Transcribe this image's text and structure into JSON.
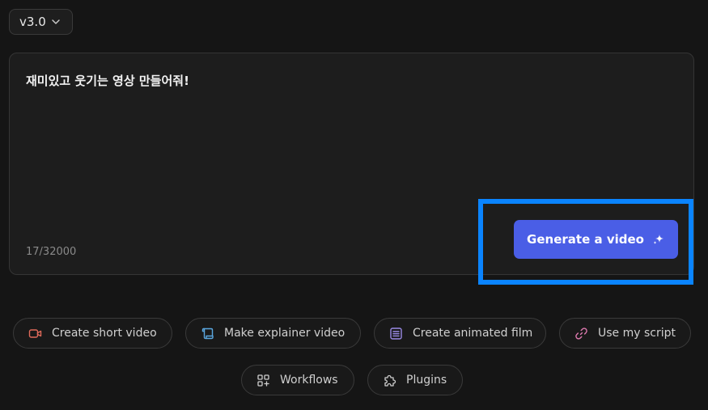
{
  "version_selector": {
    "label": "v3.0",
    "icon": "chevron-down-icon"
  },
  "prompt": {
    "text": "재미있고 웃기는 영상 만들어줘!",
    "char_count": "17/32000"
  },
  "generate_button": {
    "label": "Generate a video",
    "icon": "sparkle-icon",
    "color": "#4a5ee6",
    "highlight_color": "#0a84ff"
  },
  "quick_actions": [
    {
      "label": "Create short video",
      "icon": "video-camera-icon",
      "color": "#e06a5a"
    },
    {
      "label": "Make explainer video",
      "icon": "scroll-icon",
      "color": "#5aa7e0"
    },
    {
      "label": "Create animated film",
      "icon": "list-document-icon",
      "color": "#9a8ae6"
    },
    {
      "label": "Use my script",
      "icon": "link-icon",
      "color": "#e07ab0"
    },
    {
      "label": "Workflows",
      "icon": "grid-plus-icon",
      "color": "#cfcfcf"
    },
    {
      "label": "Plugins",
      "icon": "puzzle-icon",
      "color": "#cfcfcf"
    }
  ]
}
